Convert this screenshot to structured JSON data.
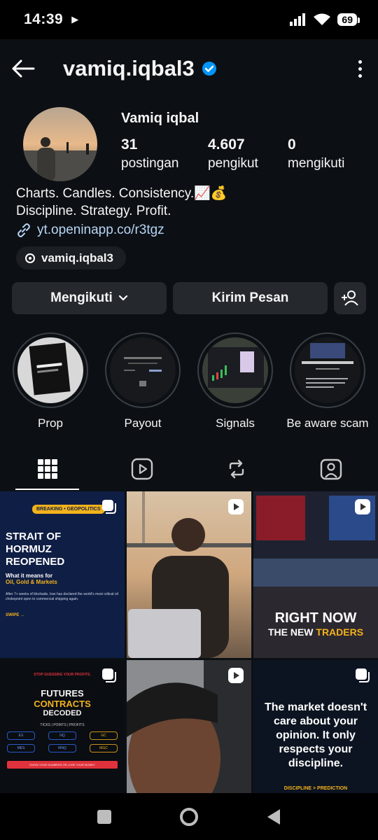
{
  "status_bar": {
    "time": "14:39",
    "battery": "69"
  },
  "profile": {
    "username": "vamiq.iqbal3",
    "full_name": "Vamiq iqbal",
    "stats": [
      {
        "value": "31",
        "label": "postingan"
      },
      {
        "value": "4.607",
        "label": "pengikut"
      },
      {
        "value": "0",
        "label": "mengikuti"
      }
    ],
    "bio_line1": "Charts. Candles. Consistency.📈💰",
    "bio_line2": "Discipline. Strategy. Profit.",
    "link": "yt.openinapp.co/r3tgz",
    "threads_handle": "vamiq.iqbal3"
  },
  "actions": {
    "follow": "Mengikuti",
    "message": "Kirim Pesan"
  },
  "highlights": [
    {
      "label": "Prop"
    },
    {
      "label": "Payout"
    },
    {
      "label": "Signals"
    },
    {
      "label": "Be aware scam"
    }
  ],
  "posts": {
    "p1": {
      "tag": "BREAKING • GEOPOLITICS",
      "line1": "STRAIT OF",
      "line2": "HORMUZ",
      "line3": "REOPENED",
      "sub": "What it means for",
      "gold": "Oil, Gold & Markets",
      "body": "After 7+ weeks of blockade, Iran has declared the world's most critical oil chokepoint open to commercial shipping again.",
      "swipe": "SWIPE →"
    },
    "p3": {
      "line1": "RIGHT NOW",
      "line2": "THE NEW",
      "line3": "TRADERS"
    },
    "p4": {
      "warn": "STOP GUESSING YOUR PROFITS.",
      "line1": "FUTURES",
      "line2": "CONTRACTS",
      "line3": "DECODED",
      "meta": "TICKS | POINTS | PROFITS",
      "pills": [
        "ES",
        "NQ",
        "GC",
        "MES",
        "MNQ",
        "MGC"
      ],
      "bar": "KNOW YOUR NUMBERS OR LOSE YOUR MONEY"
    },
    "p6": {
      "quote": "The market doesn't care about your opinion. It only respects your discipline.",
      "footer": "DISCIPLINE > PREDICTION"
    }
  },
  "colors": {
    "background": "#0c1014",
    "button": "#25292e",
    "verified": "#0095f6",
    "link": "#b8d4f5",
    "gold": "#f2b21c"
  }
}
